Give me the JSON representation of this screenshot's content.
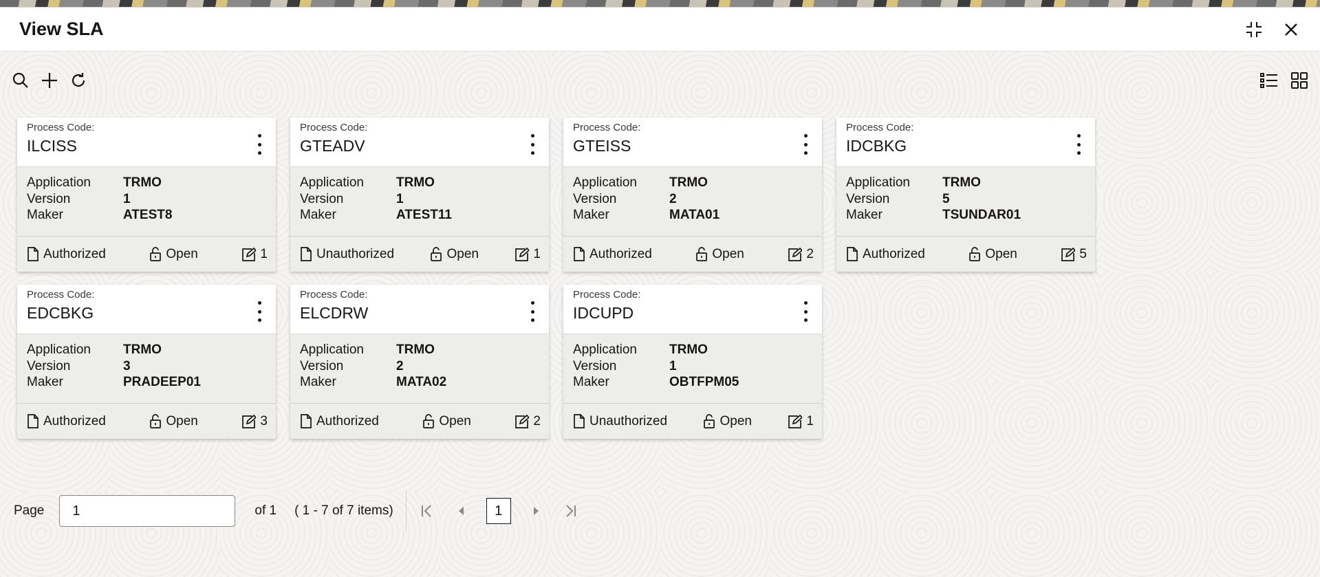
{
  "window": {
    "title": "View SLA"
  },
  "icons": {
    "minimize": "minimize-icon",
    "close": "close-icon",
    "search": "search-icon",
    "add": "plus-icon",
    "refresh": "refresh-icon",
    "list_view": "list-view-icon",
    "grid_view": "grid-view-icon"
  },
  "labels": {
    "process_code": "Process Code:",
    "application": "Application",
    "version": "Version",
    "maker": "Maker"
  },
  "cards": [
    {
      "code": "ILCISS",
      "application": "TRMO",
      "version": "1",
      "maker": "ATEST8",
      "auth": "Authorized",
      "lock": "Open",
      "mods": "1"
    },
    {
      "code": "GTEADV",
      "application": "TRMO",
      "version": "1",
      "maker": "ATEST11",
      "auth": "Unauthorized",
      "lock": "Open",
      "mods": "1"
    },
    {
      "code": "GTEISS",
      "application": "TRMO",
      "version": "2",
      "maker": "MATA01",
      "auth": "Authorized",
      "lock": "Open",
      "mods": "2"
    },
    {
      "code": "IDCBKG",
      "application": "TRMO",
      "version": "5",
      "maker": "TSUNDAR01",
      "auth": "Authorized",
      "lock": "Open",
      "mods": "5"
    },
    {
      "code": "EDCBKG",
      "application": "TRMO",
      "version": "3",
      "maker": "PRADEEP01",
      "auth": "Authorized",
      "lock": "Open",
      "mods": "3"
    },
    {
      "code": "ELCDRW",
      "application": "TRMO",
      "version": "2",
      "maker": "MATA02",
      "auth": "Authorized",
      "lock": "Open",
      "mods": "2"
    },
    {
      "code": "IDCUPD",
      "application": "TRMO",
      "version": "1",
      "maker": "OBTFPM05",
      "auth": "Unauthorized",
      "lock": "Open",
      "mods": "1"
    }
  ],
  "pager": {
    "page_label": "Page",
    "page_value": "1",
    "of_text": "of 1",
    "items_text": "( 1 - 7 of 7 items)",
    "current_page": "1"
  }
}
